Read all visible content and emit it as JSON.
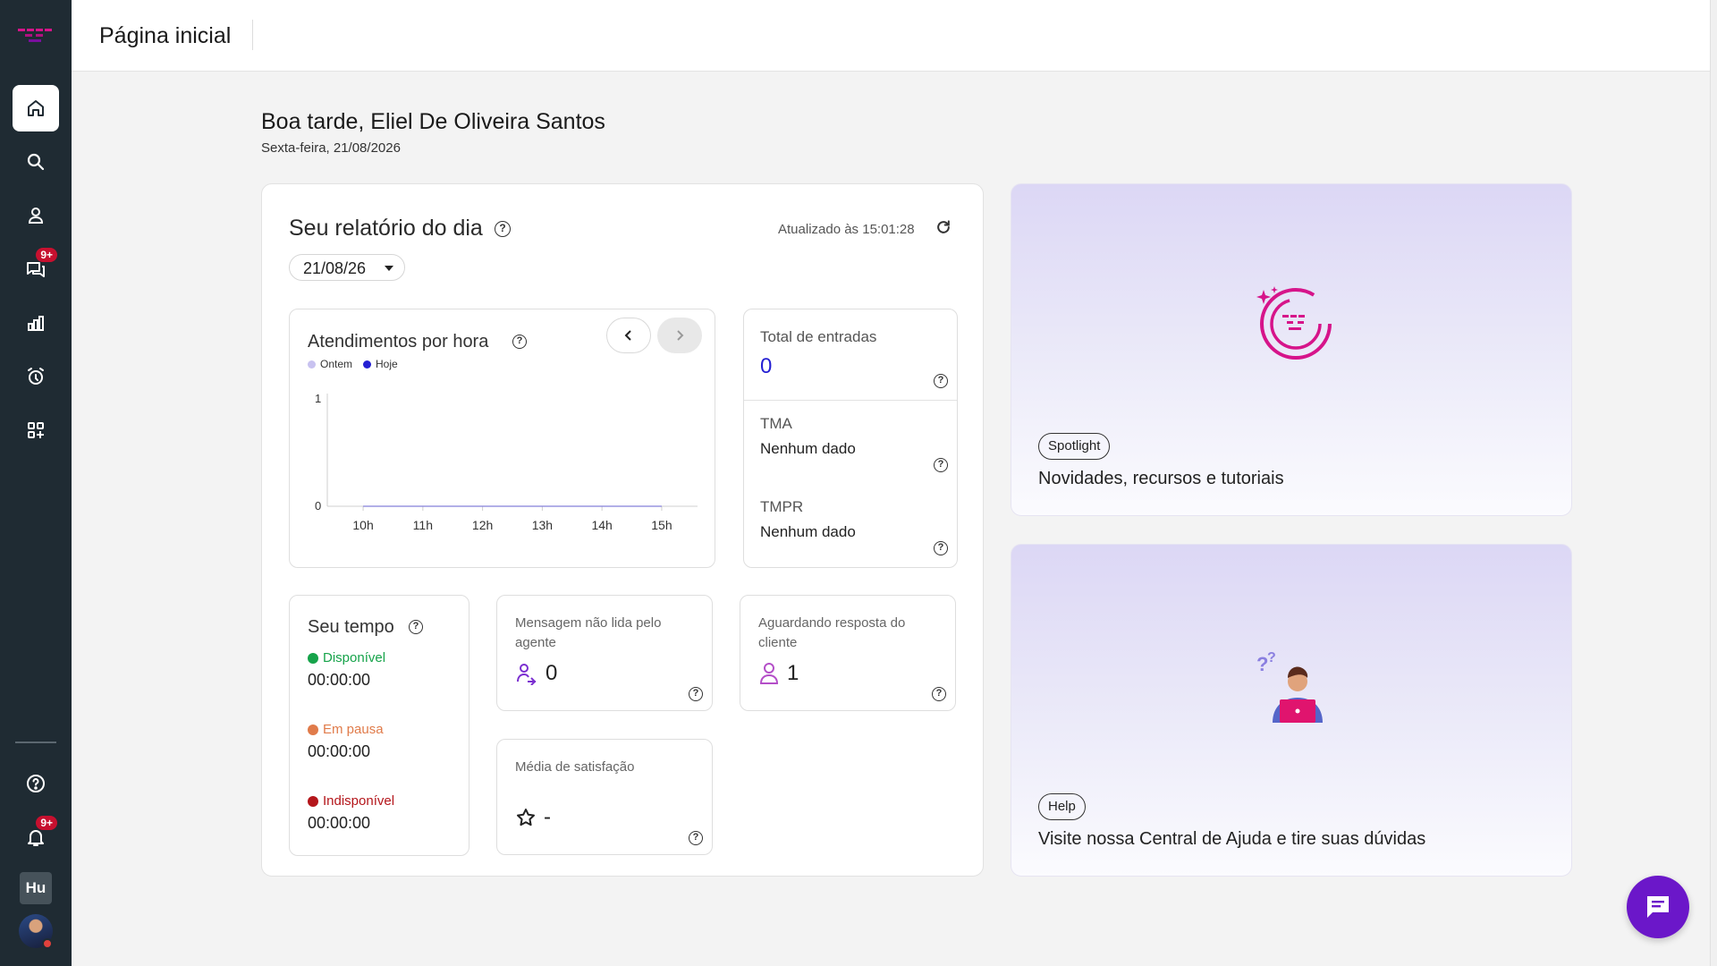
{
  "header": {
    "title": "Página inicial"
  },
  "sidebar": {
    "items": [
      {
        "name": "home",
        "icon": "home-icon",
        "active": true
      },
      {
        "name": "search",
        "icon": "search-icon"
      },
      {
        "name": "contacts",
        "icon": "person-icon"
      },
      {
        "name": "conversations",
        "icon": "chat-icon",
        "badge": "9+"
      },
      {
        "name": "reports",
        "icon": "bar-chart-icon"
      },
      {
        "name": "monitor",
        "icon": "alarm-icon"
      },
      {
        "name": "apps",
        "icon": "apps-icon"
      }
    ],
    "bottom": {
      "help_icon": "help-icon",
      "notifications_badge": "9+",
      "workspace": "Hu"
    }
  },
  "greeting": {
    "title": "Boa tarde, Eliel De Oliveira Santos",
    "date": "Sexta-feira, 21/08/2026"
  },
  "report": {
    "title": "Seu relatório do dia",
    "updated": "Atualizado às 15:01:28",
    "date_select": "21/08/26"
  },
  "chart_data": {
    "type": "line",
    "title": "Atendimentos por hora",
    "categories": [
      "10h",
      "11h",
      "12h",
      "13h",
      "14h",
      "15h"
    ],
    "series": [
      {
        "name": "Ontem",
        "color": "#c8c2f0",
        "values": [
          0,
          0,
          0,
          0,
          0,
          0
        ]
      },
      {
        "name": "Hoje",
        "color": "#2520d3",
        "values": [
          0,
          0,
          0,
          0,
          0,
          0
        ]
      }
    ],
    "ylim": [
      0,
      1
    ],
    "yticks": [
      "0",
      "1"
    ]
  },
  "stats": {
    "total": {
      "label": "Total de entradas",
      "value": "0"
    },
    "tma": {
      "label": "TMA",
      "value": "Nenhum dado"
    },
    "tmpr": {
      "label": "TMPR",
      "value": "Nenhum dado"
    }
  },
  "time": {
    "title": "Seu tempo",
    "statuses": [
      {
        "label": "Disponível",
        "color": "#16a34a",
        "time": "00:00:00"
      },
      {
        "label": "Em pausa",
        "color": "#e07b4a",
        "time": "00:00:00"
      },
      {
        "label": "Indisponível",
        "color": "#b4161b",
        "time": "00:00:00"
      }
    ]
  },
  "metrics": {
    "unread": {
      "label": "Mensagem não lida pelo agente",
      "value": "0"
    },
    "awaiting": {
      "label": "Aguardando resposta do cliente",
      "value": "1"
    },
    "satisfaction": {
      "label": "Média de satisfação",
      "value": "-"
    }
  },
  "cards": {
    "spotlight": {
      "chip": "Spotlight",
      "text": "Novidades, recursos e tutoriais"
    },
    "help": {
      "chip": "Help",
      "text": "Visite nossa Central de Ajuda e tire suas dúvidas"
    }
  },
  "colors": {
    "sidebar": "#1f2b33",
    "accent": "#6b17c9",
    "brand_pink": "#d6148a",
    "value_blue": "#2520d3"
  }
}
